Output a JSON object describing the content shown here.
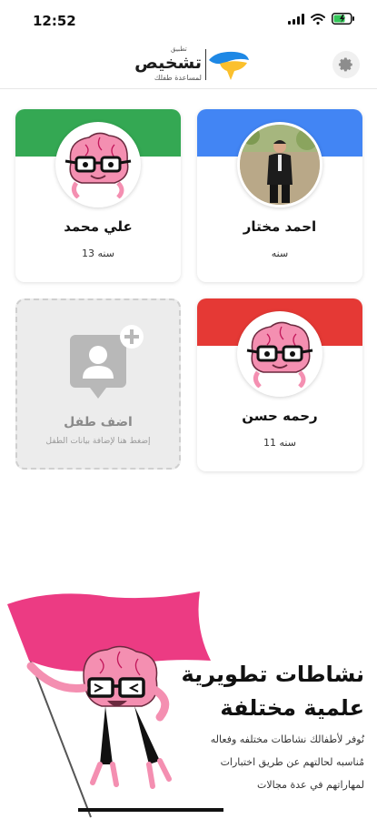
{
  "status_bar": {
    "time": "12:52",
    "icons": [
      "signal-icon",
      "wifi-icon",
      "battery-charging-icon"
    ]
  },
  "header": {
    "app_prefix": "تطبيق",
    "app_name": "تشخيص",
    "app_tagline": "لمساعدة طفلك",
    "settings_icon": "gear-icon"
  },
  "children": [
    {
      "name": "احمد مختار",
      "age": "سنه",
      "band_color": "#4285f4",
      "avatar": "photo-avatar"
    },
    {
      "name": "علي محمد",
      "age": "13 سنه",
      "band_color": "#34a853",
      "avatar": "brain-mascot-avatar"
    },
    {
      "name": "رحمه حسن",
      "age": "11 سنه",
      "band_color": "#e53935",
      "avatar": "brain-mascot-avatar"
    }
  ],
  "add_child": {
    "title": "اضف طفل",
    "subtitle": "إضغط هنا لإضافة بيانات الطفل",
    "icon": "add-person-icon"
  },
  "promo": {
    "title_line1": "نشاطات تطويرية",
    "title_line2": "علمية مختلفة",
    "body": "نُوفر لأطفالك نشاطات مختلفه وفعاله مُناسبه لحالتهم عن طريق اختبارات لمهاراتهم في عدة مجالات",
    "flag_color": "#ec3b83"
  }
}
